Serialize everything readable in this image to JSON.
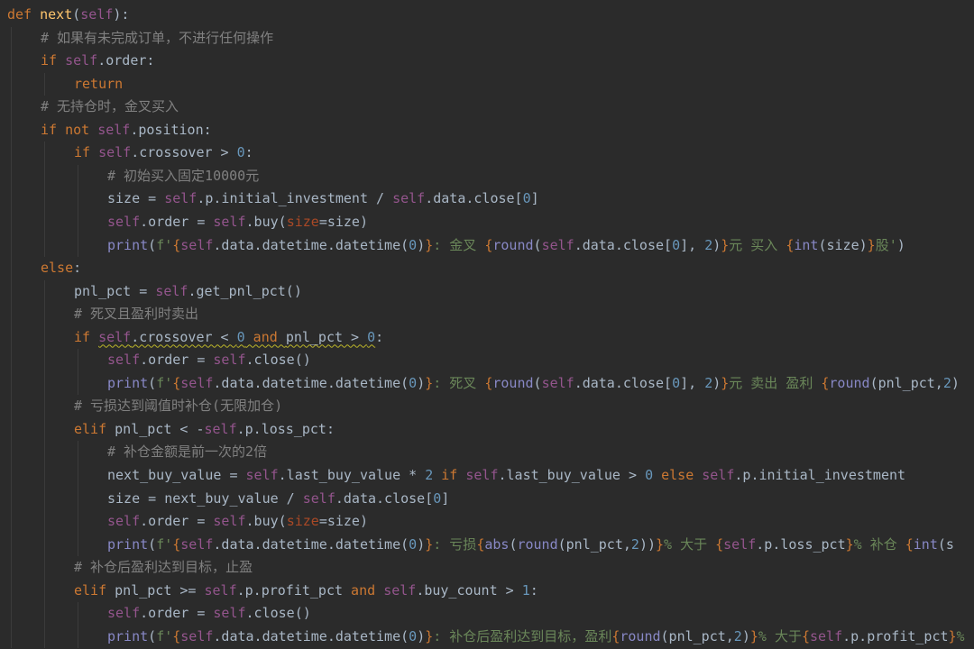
{
  "editor": {
    "language": "python",
    "theme": {
      "background": "#2b2b2b",
      "keyword": "#cc7832",
      "function": "#ffc66d",
      "self": "#94558d",
      "number": "#6897bb",
      "string": "#6a8759",
      "comment": "#808080",
      "text": "#a9b7c6"
    },
    "lines": [
      {
        "indent": 0,
        "tokens": [
          [
            "kw",
            "def "
          ],
          [
            "fn",
            "next"
          ],
          [
            "plain",
            "("
          ],
          [
            "self",
            "self"
          ],
          [
            "plain",
            "):"
          ]
        ]
      },
      {
        "indent": 1,
        "tokens": [
          [
            "cm",
            "# 如果有未完成订单，不进行任何操作"
          ]
        ]
      },
      {
        "indent": 1,
        "tokens": [
          [
            "kw",
            "if "
          ],
          [
            "self",
            "self"
          ],
          [
            "plain",
            ".order:"
          ]
        ]
      },
      {
        "indent": 2,
        "tokens": [
          [
            "kw",
            "return"
          ]
        ]
      },
      {
        "indent": 1,
        "tokens": [
          [
            "cm",
            "# 无持仓时，金叉买入"
          ]
        ]
      },
      {
        "indent": 1,
        "tokens": [
          [
            "kw",
            "if not "
          ],
          [
            "self",
            "self"
          ],
          [
            "plain",
            ".position:"
          ]
        ]
      },
      {
        "indent": 2,
        "tokens": [
          [
            "kw",
            "if "
          ],
          [
            "self",
            "self"
          ],
          [
            "plain",
            ".crossover > "
          ],
          [
            "num",
            "0"
          ],
          [
            "plain",
            ":"
          ]
        ]
      },
      {
        "indent": 3,
        "tokens": [
          [
            "cm",
            "# 初始买入固定10000元"
          ]
        ]
      },
      {
        "indent": 3,
        "tokens": [
          [
            "plain",
            "size = "
          ],
          [
            "self",
            "self"
          ],
          [
            "plain",
            ".p.initial_investment / "
          ],
          [
            "self",
            "self"
          ],
          [
            "plain",
            ".data.close["
          ],
          [
            "num",
            "0"
          ],
          [
            "plain",
            "]"
          ]
        ]
      },
      {
        "indent": 3,
        "tokens": [
          [
            "self",
            "self"
          ],
          [
            "plain",
            ".order = "
          ],
          [
            "self",
            "self"
          ],
          [
            "plain",
            ".buy("
          ],
          [
            "param",
            "size"
          ],
          [
            "plain",
            "=size)"
          ]
        ]
      },
      {
        "indent": 3,
        "tokens": [
          [
            "builtin",
            "print"
          ],
          [
            "plain",
            "("
          ],
          [
            "str",
            "f'"
          ],
          [
            "brace",
            "{"
          ],
          [
            "self",
            "self"
          ],
          [
            "plain",
            ".data.datetime.datetime("
          ],
          [
            "num",
            "0"
          ],
          [
            "plain",
            ")"
          ],
          [
            "brace",
            "}"
          ],
          [
            "str",
            ": 金叉 "
          ],
          [
            "brace",
            "{"
          ],
          [
            "builtin",
            "round"
          ],
          [
            "plain",
            "("
          ],
          [
            "self",
            "self"
          ],
          [
            "plain",
            ".data.close["
          ],
          [
            "num",
            "0"
          ],
          [
            "plain",
            "], "
          ],
          [
            "num",
            "2"
          ],
          [
            "plain",
            ")"
          ],
          [
            "brace",
            "}"
          ],
          [
            "str",
            "元 买入 "
          ],
          [
            "brace",
            "{"
          ],
          [
            "builtin",
            "int"
          ],
          [
            "plain",
            "(size)"
          ],
          [
            "brace",
            "}"
          ],
          [
            "str",
            "股'"
          ],
          [
            "plain",
            ")"
          ]
        ]
      },
      {
        "indent": 1,
        "tokens": [
          [
            "kw",
            "else"
          ],
          [
            "plain",
            ":"
          ]
        ]
      },
      {
        "indent": 2,
        "tokens": [
          [
            "plain",
            "pnl_pct = "
          ],
          [
            "self",
            "self"
          ],
          [
            "plain",
            ".get_pnl_pct()"
          ]
        ]
      },
      {
        "indent": 2,
        "tokens": [
          [
            "cm",
            "# 死叉且盈利时卖出"
          ]
        ]
      },
      {
        "indent": 2,
        "tokens": [
          [
            "kw",
            "if "
          ],
          [
            "squiggle-self",
            "self"
          ],
          [
            "squiggle",
            ".crossover < "
          ],
          [
            "squiggle-num",
            "0"
          ],
          [
            "squiggle-kw",
            " and "
          ],
          [
            "squiggle",
            "pnl_pct > "
          ],
          [
            "squiggle-num",
            "0"
          ],
          [
            "plain",
            ":"
          ]
        ]
      },
      {
        "indent": 3,
        "tokens": [
          [
            "self",
            "self"
          ],
          [
            "plain",
            ".order = "
          ],
          [
            "self",
            "self"
          ],
          [
            "plain",
            ".close()"
          ]
        ]
      },
      {
        "indent": 3,
        "tokens": [
          [
            "builtin",
            "print"
          ],
          [
            "plain",
            "("
          ],
          [
            "str",
            "f'"
          ],
          [
            "brace",
            "{"
          ],
          [
            "self",
            "self"
          ],
          [
            "plain",
            ".data.datetime.datetime("
          ],
          [
            "num",
            "0"
          ],
          [
            "plain",
            ")"
          ],
          [
            "brace",
            "}"
          ],
          [
            "str",
            ": 死叉 "
          ],
          [
            "brace",
            "{"
          ],
          [
            "builtin",
            "round"
          ],
          [
            "plain",
            "("
          ],
          [
            "self",
            "self"
          ],
          [
            "plain",
            ".data.close["
          ],
          [
            "num",
            "0"
          ],
          [
            "plain",
            "], "
          ],
          [
            "num",
            "2"
          ],
          [
            "plain",
            ")"
          ],
          [
            "brace",
            "}"
          ],
          [
            "str",
            "元 卖出 盈利 "
          ],
          [
            "brace",
            "{"
          ],
          [
            "builtin",
            "round"
          ],
          [
            "plain",
            "(pnl_pct,"
          ],
          [
            "num",
            "2"
          ],
          [
            "plain",
            ")"
          ]
        ]
      },
      {
        "indent": 2,
        "tokens": [
          [
            "cm",
            "# 亏损达到阈值时补仓(无限加仓)"
          ]
        ]
      },
      {
        "indent": 2,
        "tokens": [
          [
            "kw",
            "elif "
          ],
          [
            "plain",
            "pnl_pct < -"
          ],
          [
            "self",
            "self"
          ],
          [
            "plain",
            ".p.loss_pct:"
          ]
        ]
      },
      {
        "indent": 3,
        "tokens": [
          [
            "cm",
            "# 补仓金额是前一次的2倍"
          ]
        ]
      },
      {
        "indent": 3,
        "tokens": [
          [
            "plain",
            "next_buy_value = "
          ],
          [
            "self",
            "self"
          ],
          [
            "plain",
            ".last_buy_value * "
          ],
          [
            "num",
            "2"
          ],
          [
            "kw",
            " if "
          ],
          [
            "self",
            "self"
          ],
          [
            "plain",
            ".last_buy_value > "
          ],
          [
            "num",
            "0"
          ],
          [
            "kw",
            " else "
          ],
          [
            "self",
            "self"
          ],
          [
            "plain",
            ".p.initial_investment"
          ]
        ]
      },
      {
        "indent": 3,
        "tokens": [
          [
            "plain",
            "size = next_buy_value / "
          ],
          [
            "self",
            "self"
          ],
          [
            "plain",
            ".data.close["
          ],
          [
            "num",
            "0"
          ],
          [
            "plain",
            "]"
          ]
        ]
      },
      {
        "indent": 3,
        "tokens": [
          [
            "self",
            "self"
          ],
          [
            "plain",
            ".order = "
          ],
          [
            "self",
            "self"
          ],
          [
            "plain",
            ".buy("
          ],
          [
            "param",
            "size"
          ],
          [
            "plain",
            "=size)"
          ]
        ]
      },
      {
        "indent": 3,
        "tokens": [
          [
            "builtin",
            "print"
          ],
          [
            "plain",
            "("
          ],
          [
            "str",
            "f'"
          ],
          [
            "brace",
            "{"
          ],
          [
            "self",
            "self"
          ],
          [
            "plain",
            ".data.datetime.datetime("
          ],
          [
            "num",
            "0"
          ],
          [
            "plain",
            ")"
          ],
          [
            "brace",
            "}"
          ],
          [
            "str",
            ": 亏损"
          ],
          [
            "brace",
            "{"
          ],
          [
            "builtin",
            "abs"
          ],
          [
            "plain",
            "("
          ],
          [
            "builtin",
            "round"
          ],
          [
            "plain",
            "(pnl_pct,"
          ],
          [
            "num",
            "2"
          ],
          [
            "plain",
            "))"
          ],
          [
            "brace",
            "}"
          ],
          [
            "str",
            "% 大于 "
          ],
          [
            "brace",
            "{"
          ],
          [
            "self",
            "self"
          ],
          [
            "plain",
            ".p.loss_pct"
          ],
          [
            "brace",
            "}"
          ],
          [
            "str",
            "% 补仓 "
          ],
          [
            "brace",
            "{"
          ],
          [
            "builtin",
            "int"
          ],
          [
            "plain",
            "(s"
          ]
        ]
      },
      {
        "indent": 2,
        "tokens": [
          [
            "cm",
            "# 补仓后盈利达到目标，止盈"
          ]
        ]
      },
      {
        "indent": 2,
        "tokens": [
          [
            "kw",
            "elif "
          ],
          [
            "plain",
            "pnl_pct >= "
          ],
          [
            "self",
            "self"
          ],
          [
            "plain",
            ".p.profit_pct"
          ],
          [
            "kw",
            " and "
          ],
          [
            "self",
            "self"
          ],
          [
            "plain",
            ".buy_count > "
          ],
          [
            "num",
            "1"
          ],
          [
            "plain",
            ":"
          ]
        ]
      },
      {
        "indent": 3,
        "tokens": [
          [
            "self",
            "self"
          ],
          [
            "plain",
            ".order = "
          ],
          [
            "self",
            "self"
          ],
          [
            "plain",
            ".close()"
          ]
        ]
      },
      {
        "indent": 3,
        "tokens": [
          [
            "builtin",
            "print"
          ],
          [
            "plain",
            "("
          ],
          [
            "str",
            "f'"
          ],
          [
            "brace",
            "{"
          ],
          [
            "self",
            "self"
          ],
          [
            "plain",
            ".data.datetime.datetime("
          ],
          [
            "num",
            "0"
          ],
          [
            "plain",
            ")"
          ],
          [
            "brace",
            "}"
          ],
          [
            "str",
            ": 补仓后盈利达到目标，盈利"
          ],
          [
            "brace",
            "{"
          ],
          [
            "builtin",
            "round"
          ],
          [
            "plain",
            "(pnl_pct,"
          ],
          [
            "num",
            "2"
          ],
          [
            "plain",
            ")"
          ],
          [
            "brace",
            "}"
          ],
          [
            "str",
            "% 大于"
          ],
          [
            "brace",
            "{"
          ],
          [
            "self",
            "self"
          ],
          [
            "plain",
            ".p.profit_pct"
          ],
          [
            "brace",
            "}"
          ],
          [
            "str",
            "%"
          ]
        ]
      }
    ]
  }
}
